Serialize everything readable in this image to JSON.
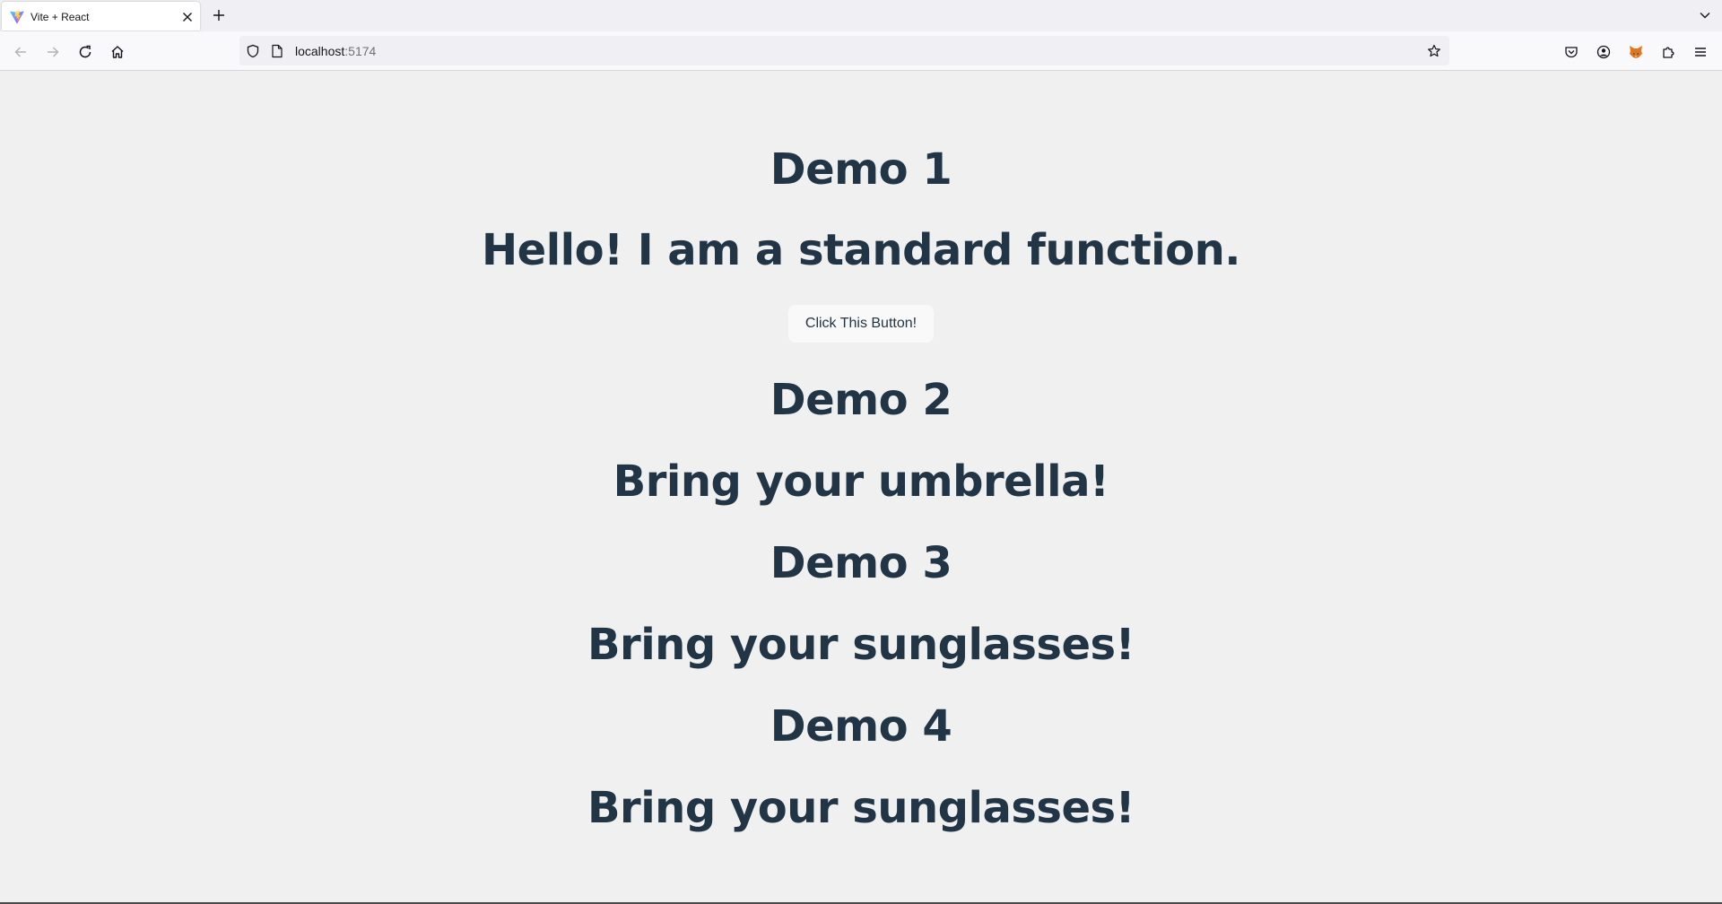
{
  "browser": {
    "tab": {
      "title": "Vite + React",
      "favicon": "vite-logo-icon"
    },
    "address_bar": {
      "host": "localhost",
      "port": ":5174"
    },
    "icons": {
      "back": "arrow-left-icon",
      "forward": "arrow-right-icon",
      "reload": "reload-icon",
      "home": "home-icon",
      "tracking_protection": "shield-icon",
      "page_info": "page-icon",
      "bookmark": "star-icon",
      "pocket": "pocket-icon",
      "account": "account-icon",
      "extension_fox": "fox-extension-icon",
      "extensions": "puzzle-icon",
      "menu": "hamburger-menu-icon",
      "new_tab": "plus-icon",
      "list_tabs": "chevron-down-icon",
      "close_tab": "close-icon"
    }
  },
  "page": {
    "demo1": {
      "heading": "Demo 1",
      "message": "Hello! I am a standard function.",
      "button_label": "Click This Button!"
    },
    "demo2": {
      "heading": "Demo 2",
      "message": "Bring your umbrella!"
    },
    "demo3": {
      "heading": "Demo 3",
      "message": "Bring your sunglasses!"
    },
    "demo4": {
      "heading": "Demo 4",
      "message": "Bring your sunglasses!"
    }
  },
  "colors": {
    "text": "#213547",
    "page_background": "#f0f0f0",
    "button_background": "#f9f9f9"
  }
}
